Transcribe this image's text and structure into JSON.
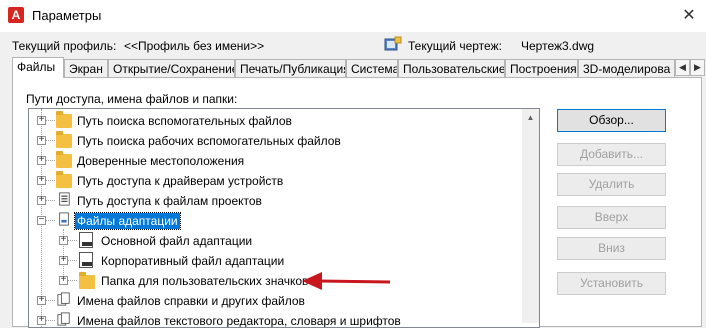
{
  "window": {
    "title": "Параметры",
    "app_icon": "A",
    "close_glyph": "✕"
  },
  "profile": {
    "label": "Текущий профиль:",
    "value": "<<Профиль без имени>>"
  },
  "drawing": {
    "label": "Текущий чертеж:",
    "value": "Чертеж3.dwg"
  },
  "tabs": [
    "Файлы",
    "Экран",
    "Открытие/Сохранение",
    "Печать/Публикация",
    "Система",
    "Пользовательские",
    "Построения",
    "3D-моделирова"
  ],
  "active_tab": "Файлы",
  "panel": {
    "paths_label": "Пути доступа, имена файлов и папки:"
  },
  "tree": [
    {
      "label": "Путь поиска вспомогательных файлов",
      "icon": "folder-icon"
    },
    {
      "label": "Путь поиска рабочих вспомогательных файлов",
      "icon": "folder-icon"
    },
    {
      "label": "Доверенные местоположения",
      "icon": "folder-icon"
    },
    {
      "label": "Путь доступа к драйверам устройств",
      "icon": "folder-icon"
    },
    {
      "label": "Путь доступа к файлам проектов",
      "icon": "project-file-icon"
    },
    {
      "label": "Файлы адаптации",
      "icon": "customization-files-icon",
      "selected": true
    },
    {
      "label": "Основной файл адаптации",
      "icon": "cui-file-icon"
    },
    {
      "label": "Корпоративный файл адаптации",
      "icon": "cui-file-icon"
    },
    {
      "label": "Папка для пользовательских значков",
      "icon": "folder-icon"
    },
    {
      "label": "Имена файлов справки и других файлов",
      "icon": "files-icon"
    },
    {
      "label": "Имена файлов текстового редактора, словаря и шрифтов",
      "icon": "files-icon"
    }
  ],
  "buttons": {
    "browse": "Обзор...",
    "add": "Добавить...",
    "remove": "Удалить",
    "move_up": "Вверх",
    "move_down": "Вниз",
    "set_current": "Установить"
  },
  "colors": {
    "accent": "#0078d7",
    "arrow": "#c8171e",
    "folder": "#f3c042"
  }
}
